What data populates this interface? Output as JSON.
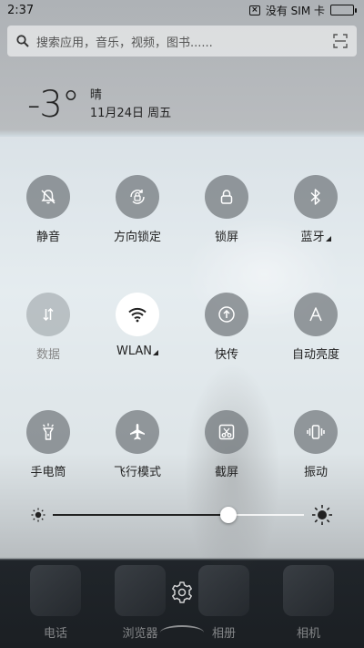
{
  "status_bar": {
    "time": "2:37",
    "sim_text": "没有 SIM 卡",
    "battery_level": 0.92
  },
  "search": {
    "placeholder": "搜索应用，音乐，视频，图书......"
  },
  "weather": {
    "temperature": "-3°",
    "condition": "晴",
    "date": "11月24日 周五"
  },
  "toggles": [
    {
      "label": "静音",
      "icon": "bell-off-icon",
      "state": "off"
    },
    {
      "label": "方向锁定",
      "icon": "rotation-lock-icon",
      "state": "off"
    },
    {
      "label": "锁屏",
      "icon": "lock-icon",
      "state": "off"
    },
    {
      "label": "蓝牙",
      "icon": "bluetooth-icon",
      "state": "off",
      "has_menu": true
    },
    {
      "label": "数据",
      "icon": "mobile-data-icon",
      "state": "disabled"
    },
    {
      "label": "WLAN",
      "icon": "wifi-icon",
      "state": "on",
      "has_menu": true
    },
    {
      "label": "快传",
      "icon": "quick-transfer-icon",
      "state": "off"
    },
    {
      "label": "自动亮度",
      "icon": "auto-brightness-icon",
      "state": "off"
    },
    {
      "label": "手电筒",
      "icon": "flashlight-icon",
      "state": "off"
    },
    {
      "label": "飞行模式",
      "icon": "airplane-icon",
      "state": "off"
    },
    {
      "label": "截屏",
      "icon": "screenshot-icon",
      "state": "off"
    },
    {
      "label": "振动",
      "icon": "vibrate-icon",
      "state": "off"
    }
  ],
  "brightness": {
    "level": 0.7
  },
  "dock": [
    {
      "label": "电话",
      "icon": "phone-app-icon"
    },
    {
      "label": "浏览器",
      "icon": "browser-app-icon"
    },
    {
      "label": "相册",
      "icon": "gallery-app-icon"
    },
    {
      "label": "相机",
      "icon": "camera-app-icon"
    }
  ],
  "colors": {
    "active_toggle": "#ffffff",
    "battery": "#3bc23b"
  }
}
